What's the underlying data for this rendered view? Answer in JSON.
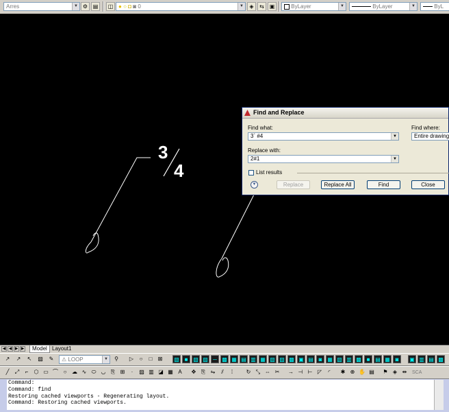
{
  "top_toolbar": {
    "text_style_value": "Arres",
    "layer_value": "0",
    "color_value": "ByLayer",
    "linetype_value": "ByLayer",
    "lineweight_value": "ByLayer",
    "plotstyle_value": "ByL"
  },
  "drawing": {
    "fraction_numerator": "3",
    "fraction_denominator": "4"
  },
  "find_dialog": {
    "title": "Find and Replace",
    "find_what_label": "Find what:",
    "find_what_value": "3` #4",
    "replace_with_label": "Replace with:",
    "replace_with_value": "2#1",
    "find_where_label": "Find where:",
    "find_where_value": "Entire drawing",
    "list_results_label": "List results",
    "replace_button": "Replace",
    "replace_all_button": "Replace All",
    "find_button": "Find",
    "close_button": "Close"
  },
  "layout_tabs": {
    "model": "Model",
    "layout1": "Layout1"
  },
  "toolbar2": {
    "loop_value": "LOOP"
  },
  "toolbar3": {
    "scale_value": "SCA"
  },
  "command_line": {
    "lines": [
      "Command:",
      "Command: find",
      "Restoring cached viewports - Regenerating layout.",
      "Command: Restoring cached viewports."
    ]
  },
  "colors": {
    "canvas": "#000000",
    "dialog_face": "#ece9d8",
    "command_bg": "#c6cce9"
  }
}
